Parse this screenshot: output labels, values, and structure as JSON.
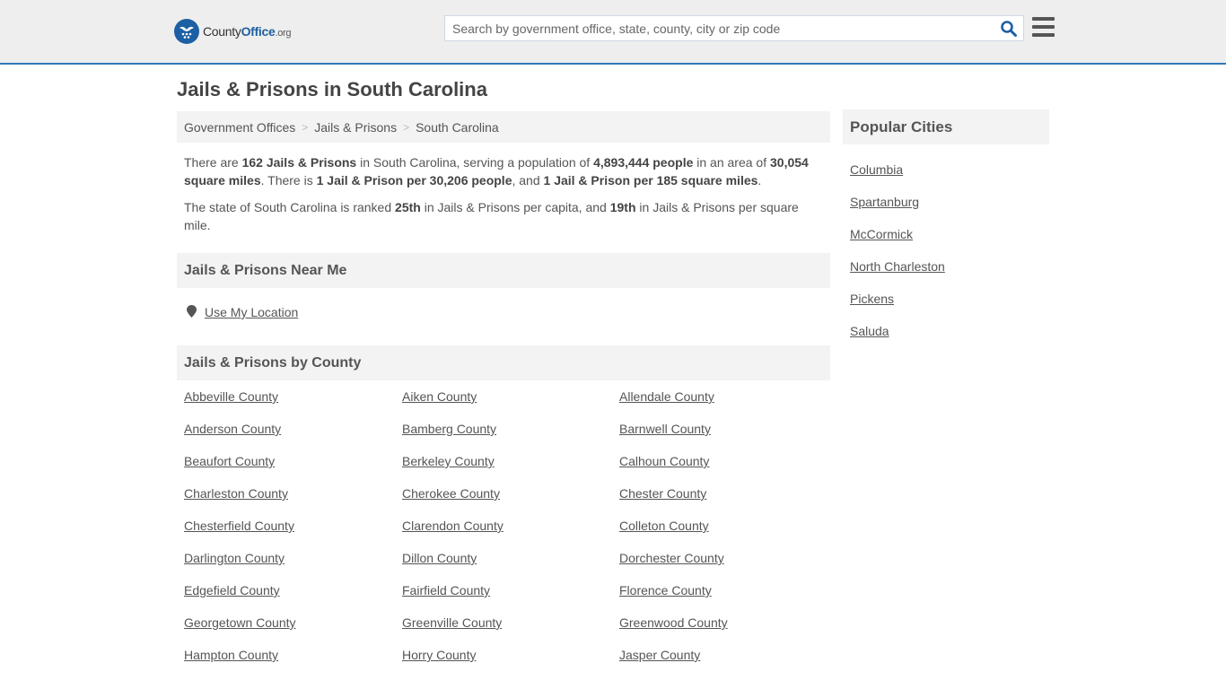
{
  "header": {
    "logo": {
      "name_part1": "County",
      "name_part2": "Office",
      "tld": ".org"
    },
    "search": {
      "placeholder": "Search by government office, state, county, city or zip code",
      "value": ""
    },
    "brand_color": "#1d5fa3",
    "accent_border_color": "#2f79b9"
  },
  "page": {
    "title": "Jails & Prisons in South Carolina"
  },
  "breadcrumb": [
    "Government Offices",
    "Jails & Prisons",
    "South Carolina"
  ],
  "intro": {
    "p1": {
      "t1": "There are ",
      "b1": "162 Jails & Prisons",
      "t2": " in South Carolina, serving a population of ",
      "b2": "4,893,444 people",
      "t3": " in an area of ",
      "b3": "30,054 square miles",
      "t4": ". There is ",
      "b4": "1 Jail & Prison per 30,206 people",
      "t5": ", and ",
      "b5": "1 Jail & Prison per 185 square miles",
      "t6": "."
    },
    "p2": {
      "t1": "The state of South Carolina is ranked ",
      "b1": "25th",
      "t2": " in Jails & Prisons per capita, and ",
      "b2": "19th",
      "t3": " in Jails & Prisons per square mile."
    }
  },
  "near_me": {
    "heading": "Jails & Prisons Near Me",
    "link": "Use My Location"
  },
  "by_county": {
    "heading": "Jails & Prisons by County",
    "counties": [
      "Abbeville County",
      "Aiken County",
      "Allendale County",
      "Anderson County",
      "Bamberg County",
      "Barnwell County",
      "Beaufort County",
      "Berkeley County",
      "Calhoun County",
      "Charleston County",
      "Cherokee County",
      "Chester County",
      "Chesterfield County",
      "Clarendon County",
      "Colleton County",
      "Darlington County",
      "Dillon County",
      "Dorchester County",
      "Edgefield County",
      "Fairfield County",
      "Florence County",
      "Georgetown County",
      "Greenville County",
      "Greenwood County",
      "Hampton County",
      "Horry County",
      "Jasper County"
    ]
  },
  "sidebar": {
    "heading": "Popular Cities",
    "cities": [
      "Columbia",
      "Spartanburg",
      "McCormick",
      "North Charleston",
      "Pickens",
      "Saluda"
    ]
  }
}
